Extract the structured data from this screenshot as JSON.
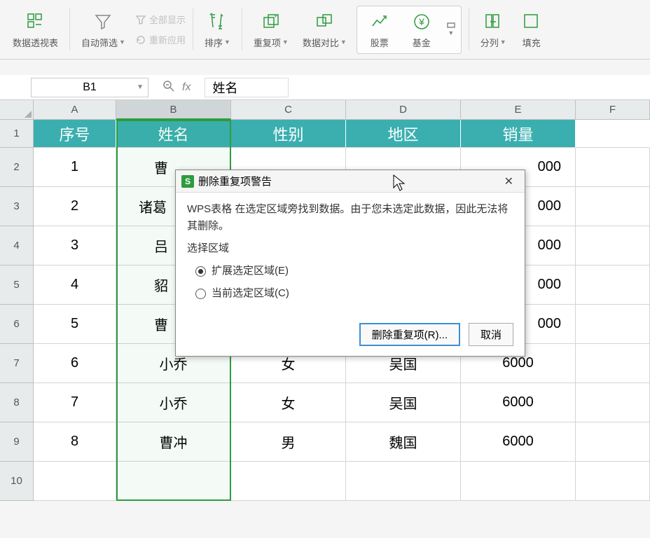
{
  "toolbar": {
    "pivot": "数据透视表",
    "autofilter": "自动筛选",
    "showAll": "全部显示",
    "reapply": "重新应用",
    "sort": "排序",
    "duplicates": "重复项",
    "dataCompare": "数据对比",
    "stock": "股票",
    "fund": "基金",
    "splitCol": "分列",
    "fill": "填充"
  },
  "nameBox": "B1",
  "fx": "fx",
  "formulaValue": "姓名",
  "columns": [
    "A",
    "B",
    "C",
    "D",
    "E",
    "F"
  ],
  "headerRow": {
    "A": "序号",
    "B": "姓名",
    "C": "性别",
    "D": "地区",
    "E": "销量"
  },
  "rows": [
    {
      "n": "1",
      "A": "1",
      "B": "曹",
      "C": "",
      "D": "",
      "E": "000"
    },
    {
      "n": "2",
      "A": "2",
      "B": "诸葛",
      "C": "",
      "D": "",
      "E": "000"
    },
    {
      "n": "3",
      "A": "3",
      "B": "吕",
      "C": "",
      "D": "",
      "E": "000"
    },
    {
      "n": "4",
      "A": "4",
      "B": "貂",
      "C": "",
      "D": "",
      "E": "000"
    },
    {
      "n": "5",
      "A": "5",
      "B": "曹",
      "C": "",
      "D": "",
      "E": "000"
    },
    {
      "n": "6",
      "A": "6",
      "B": "小乔",
      "C": "女",
      "D": "吴国",
      "E": "6000"
    },
    {
      "n": "7",
      "A": "7",
      "B": "小乔",
      "C": "女",
      "D": "吴国",
      "E": "6000"
    },
    {
      "n": "8",
      "A": "8",
      "B": "曹冲",
      "C": "男",
      "D": "魏国",
      "E": "6000"
    },
    {
      "n": "9",
      "A": "",
      "B": "",
      "C": "",
      "D": "",
      "E": ""
    }
  ],
  "dialog": {
    "title": "删除重复项警告",
    "body": "WPS表格 在选定区域旁找到数据。由于您未选定此数据，因此无法将其删除。",
    "section": "选择区域",
    "opt1": "扩展选定区域(E)",
    "opt2": "当前选定区域(C)",
    "primaryBtn": "删除重复项(R)...",
    "cancelBtn": "取消"
  }
}
